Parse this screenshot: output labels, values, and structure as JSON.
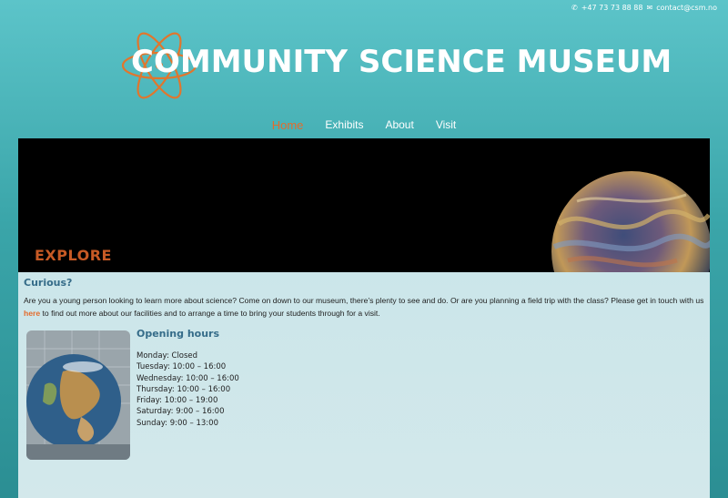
{
  "contact": {
    "phone_icon": "phone-icon",
    "phone": "+47 73 73 88 88",
    "email_icon": "envelope-icon",
    "email": "contact@csm.no"
  },
  "brand": {
    "logo_text": "COMMUNITY SCIENCE MUSEUM",
    "logo_icon": "atom-icon"
  },
  "nav": {
    "home": "Home",
    "exhibits": "Exhibits",
    "about": "About",
    "visit": "Visit"
  },
  "hero": {
    "title": "EXPLORE"
  },
  "main": {
    "heading": "Curious?",
    "intro_before": "Are you a young person looking to learn more about science? Come on down to our museum, there’s plenty to see and do. Or are you planning a field trip with the class? Please get in touch with us ",
    "intro_link": "here",
    "intro_after": " to find out more about our facilities and to arrange a time to bring your students through for a visit."
  },
  "hours": {
    "title": "Opening hours",
    "days": [
      "Monday: Closed",
      "Tuesday: 10:00 – 16:00",
      "Wednesday: 10:00 – 16:00",
      "Thursday: 10:00 – 16:00",
      "Friday: 10:00 – 19:00",
      "Saturday: 9:00 – 16:00",
      "Sunday: 9:00 – 13:00"
    ]
  },
  "colors": {
    "accent": "#e36b2c",
    "heading": "#356c89",
    "background": "#4ab4b9"
  }
}
